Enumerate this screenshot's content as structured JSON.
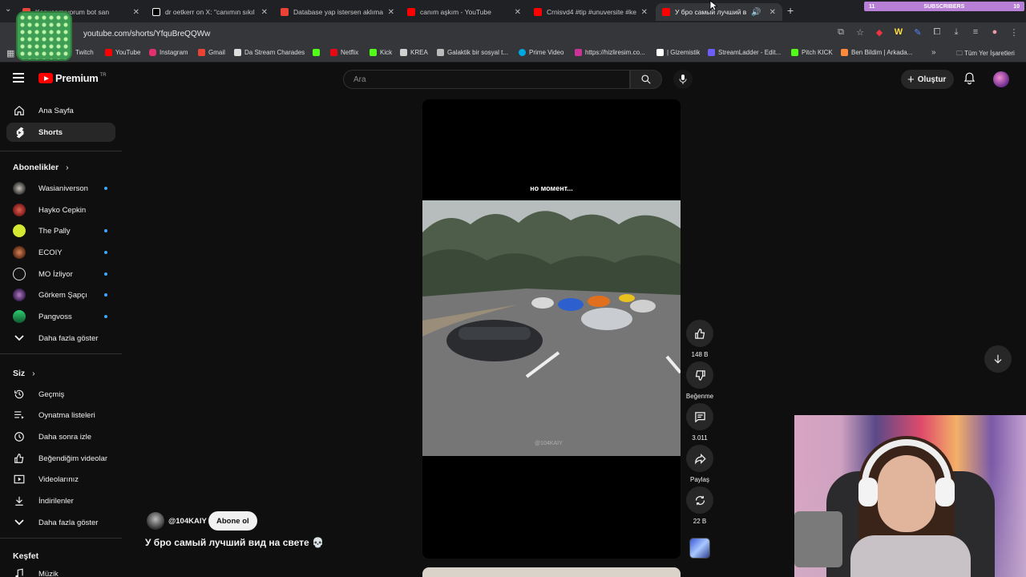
{
  "browser": {
    "tabs": [
      {
        "title": "Konuşamıyorum bot san",
        "favicon_color": "#e8453c"
      },
      {
        "title": "dr oetkerr on X: \"canımın sıkıl",
        "favicon_color": "#ffffff"
      },
      {
        "title": "Database yap istersen aklıma g",
        "favicon_color": "#ea4335"
      },
      {
        "title": "canım aşkım - YouTube",
        "favicon_color": "#ff0000"
      },
      {
        "title": "Crnisvd4 #tip #unuversite #ke",
        "favicon_color": "#ff0000"
      },
      {
        "title": "У бро самый лучший вид",
        "favicon_color": "#ff0000",
        "active": true
      }
    ],
    "url": "youtube.com/shorts/YfquBreQQWw",
    "subscribers_overlay": {
      "left": "11",
      "label": "SUBSCRIBERS",
      "right": "10"
    },
    "bookmarks": [
      {
        "label": "Twitch",
        "color": "#9146ff"
      },
      {
        "label": "YouTube",
        "color": "#ff0000"
      },
      {
        "label": "Instagram",
        "color": "#e1306c"
      },
      {
        "label": "Gmail",
        "color": "#ea4335"
      },
      {
        "label": "Da Stream Charades",
        "color": "#dddddd"
      },
      {
        "label": "",
        "color": "#53fc18"
      },
      {
        "label": "Netflix",
        "color": "#e50914"
      },
      {
        "label": "Kick",
        "color": "#53fc18"
      },
      {
        "label": "KREA",
        "color": "#d0d0d0"
      },
      {
        "label": "Galaktik bir sosyal t...",
        "color": "#bbbbbb"
      },
      {
        "label": "Prime Video",
        "color": "#00a8e1"
      },
      {
        "label": "https://hizliresim.co...",
        "color": "#cc3399"
      },
      {
        "label": "| Gizemistik",
        "color": "#ffffff"
      },
      {
        "label": "StreamLadder - Edit...",
        "color": "#6d5dfc"
      },
      {
        "label": "Pitch KICK",
        "color": "#53fc18"
      },
      {
        "label": "Ben Bildim | Arkada...",
        "color": "#ff8a3d"
      }
    ],
    "bookmarks_all": "Tüm Yer İşaretleri"
  },
  "header": {
    "logo_text": "Premium",
    "country": "TR",
    "search_placeholder": "Ara",
    "create_label": "Oluştur"
  },
  "sidebar": {
    "main": [
      {
        "label": "Ana Sayfa",
        "icon": "home-icon"
      },
      {
        "label": "Shorts",
        "icon": "shorts-icon",
        "active": true
      }
    ],
    "subscriptions_title": "Abonelikler",
    "subscriptions": [
      {
        "label": "Wasianiverson",
        "color": "#c9c3b8",
        "dot": true
      },
      {
        "label": "Hayko Cepkin",
        "color": "#c0392b",
        "dot": false
      },
      {
        "label": "The Pally",
        "color": "#d4e833",
        "dot": true
      },
      {
        "label": "ECOIY",
        "color": "#a0522d",
        "dot": true
      },
      {
        "label": "MO İzliyor",
        "color": "#dddddd",
        "dot": true
      },
      {
        "label": "Görkem Şapçı",
        "color": "#8e44ad",
        "dot": true
      },
      {
        "label": "Pangvoss",
        "color": "#2ecc71",
        "dot": true
      }
    ],
    "subs_more": "Daha fazla göster",
    "you_title": "Siz",
    "you_items": [
      {
        "label": "Geçmiş",
        "icon": "history-icon"
      },
      {
        "label": "Oynatma listeleri",
        "icon": "playlists-icon"
      },
      {
        "label": "Daha sonra izle",
        "icon": "watch-later-icon"
      },
      {
        "label": "Beğendiğim videolar",
        "icon": "liked-icon"
      },
      {
        "label": "Videolarınız",
        "icon": "your-videos-icon"
      },
      {
        "label": "İndirilenler",
        "icon": "downloads-icon"
      }
    ],
    "you_more": "Daha fazla göster",
    "explore_title": "Keşfet",
    "explore_items": [
      {
        "label": "Müzik",
        "icon": "music-icon"
      }
    ]
  },
  "short": {
    "caption": "но момент...",
    "watermark": "@104KAIY",
    "channel": "@104KAIY",
    "subscribe_label": "Abone ol",
    "title": "У бро самый лучший вид на свете 💀"
  },
  "actions": {
    "likes": "148 B",
    "dislike_label": "Beğenme",
    "comments": "3.011",
    "share_label": "Paylaş",
    "remix_count": "22 B"
  }
}
